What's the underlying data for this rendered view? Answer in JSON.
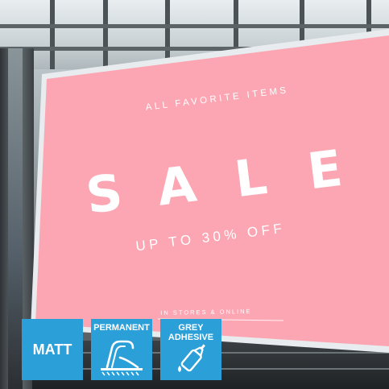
{
  "billboard": {
    "tagline": "ALL FAVORITE ITEMS",
    "headline_letters": [
      "S",
      "A",
      "L",
      "E"
    ],
    "offer": "UP TO 30% OFF",
    "footer": "IN STORES & ONLINE",
    "color": "#fda6b3"
  },
  "badges": [
    {
      "label": "MATT",
      "icon": "none"
    },
    {
      "label": "PERMANENT",
      "icon": "permanent-bond-icon"
    },
    {
      "label": "GREY ADHESIVE",
      "label_lines": [
        "GREY",
        "ADHESIVE"
      ],
      "icon": "glue-bottle-icon"
    }
  ],
  "colors": {
    "badge_blue": "#2a9fd8",
    "billboard_pink": "#fda6b3",
    "text_white": "#ffffff"
  }
}
